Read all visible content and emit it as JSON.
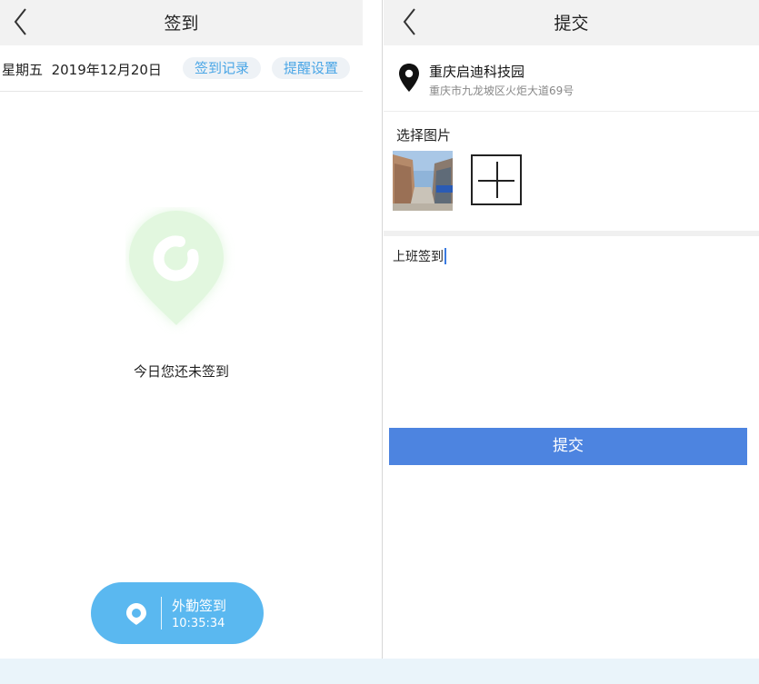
{
  "left": {
    "header": {
      "title": "签到"
    },
    "datebar": {
      "weekday": "星期五",
      "date": "2019年12月20日",
      "records_label": "签到记录",
      "reminder_label": "提醒设置"
    },
    "status_text": "今日您还未签到",
    "field_checkin": {
      "label": "外勤签到",
      "time": "10:35:34"
    }
  },
  "right": {
    "header": {
      "title": "提交"
    },
    "location": {
      "name": "重庆启迪科技园",
      "address": "重庆市九龙坡区火炬大道69号"
    },
    "pictures": {
      "label": "选择图片"
    },
    "note": {
      "value": "上班签到"
    },
    "submit_label": "提交"
  },
  "colors": {
    "accent_blue": "#4d84e0",
    "pill_text": "#4aa6e6",
    "field_button": "#5ab8f0",
    "pin_green": "#d8f4d6"
  },
  "icons": [
    "back-arrow-icon",
    "location-pin-icon",
    "map-pin-icon",
    "add-plus-icon"
  ]
}
